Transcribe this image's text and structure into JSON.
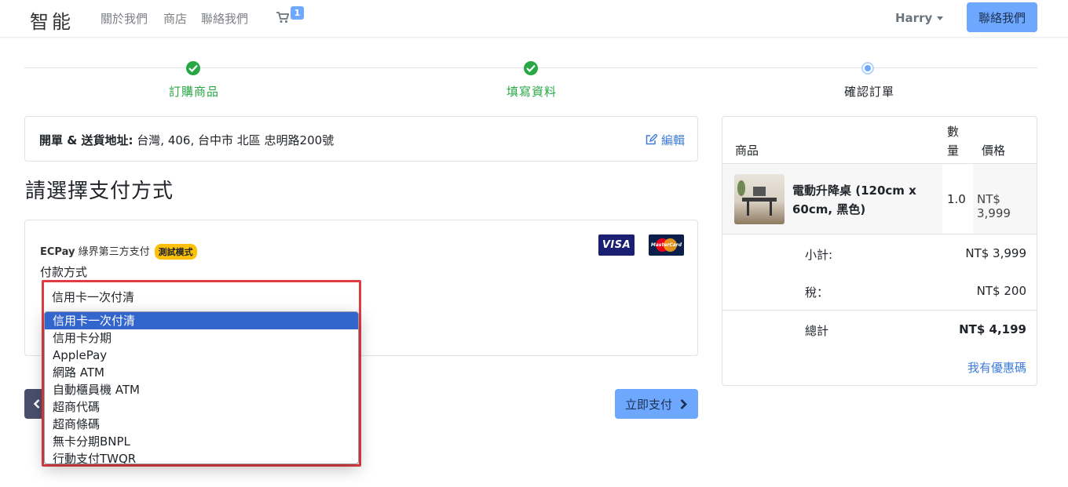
{
  "nav": {
    "brand": "智能",
    "links": [
      "關於我們",
      "商店",
      "聯絡我們"
    ],
    "cart_count": "1",
    "user": "Harry",
    "contact_button": "聯絡我們"
  },
  "steps": [
    {
      "label": "訂購商品",
      "state": "done"
    },
    {
      "label": "填寫資料",
      "state": "done"
    },
    {
      "label": "確認訂單",
      "state": "current"
    }
  ],
  "address": {
    "label": "開單 & 送貨地址:",
    "value": " 台灣, 406, 台中市 北區 忠明路200號",
    "edit": "編輯"
  },
  "payment": {
    "heading": "請選擇支付方式",
    "provider_name": "ECPay",
    "provider_desc": " 綠界第三方支付",
    "test_badge": "測試模式",
    "visa_text": "VISA",
    "mastercard_text": "MasterCard",
    "method_label": "付款方式",
    "selected": "信用卡一次付清",
    "options": [
      "信用卡一次付清",
      "信用卡分期",
      "ApplePay",
      "網路 ATM",
      "自動櫃員機 ATM",
      "超商代碼",
      "超商條碼",
      "無卡分期BNPL",
      "行動支付TWQR"
    ],
    "pay_button": "立即支付"
  },
  "order": {
    "headers": {
      "product": "商品",
      "qty_line1": "數",
      "qty_line2": "量",
      "price": "價格"
    },
    "item": {
      "name": "電動升降桌 (120cm x 60cm, 黑色)",
      "qty": "1.0",
      "price": "NT$ 3,999"
    },
    "subtotal_label": "小計:",
    "subtotal": "NT$ 3,999",
    "tax_label": "稅：",
    "tax": "NT$ 200",
    "total_label": "總計",
    "total": "NT$ 4,199",
    "coupon": "我有優惠碼"
  },
  "colors": {
    "primary": "#6ea8fe",
    "success": "#28a745",
    "link": "#3d7cd9",
    "highlight": "#e03c44"
  }
}
